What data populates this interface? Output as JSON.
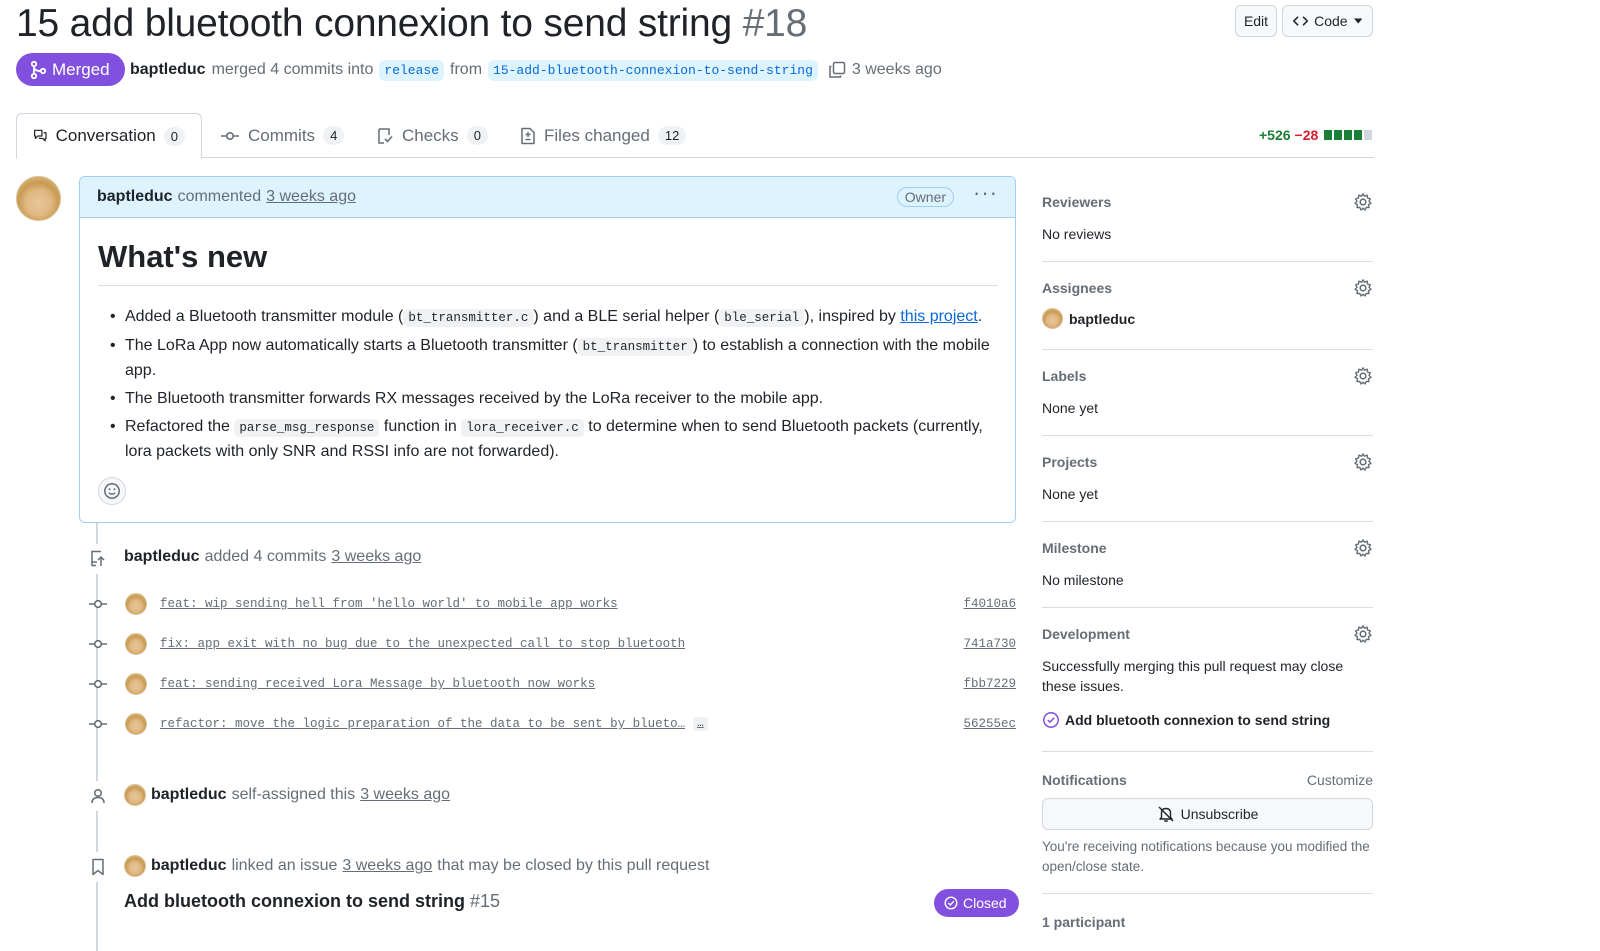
{
  "pr": {
    "title": "15 add bluetooth connexion to send string",
    "number": "#18",
    "state": "Merged",
    "author": "baptleduc",
    "merged_text": "merged 4 commits into",
    "base_branch": "release",
    "from_text": "from",
    "head_branch": "15-add-bluetooth-connexion-to-send-string",
    "time": "3 weeks ago",
    "edit_label": "Edit",
    "code_label": "Code"
  },
  "tabs": [
    {
      "label": "Conversation",
      "count": "0"
    },
    {
      "label": "Commits",
      "count": "4"
    },
    {
      "label": "Checks",
      "count": "0"
    },
    {
      "label": "Files changed",
      "count": "12"
    }
  ],
  "diffstat": {
    "additions": "+526",
    "deletions": "−28",
    "blocks": [
      1,
      1,
      1,
      1,
      0
    ]
  },
  "comment": {
    "author": "baptleduc",
    "action": "commented",
    "time": "3 weeks ago",
    "role": "Owner",
    "heading": "What's new",
    "items": [
      {
        "t1": "Added a Bluetooth transmitter module (",
        "c1": "bt_transmitter.c",
        "t2": ") and a BLE serial helper (",
        "c2": "ble_serial",
        "t3": "), inspired by ",
        "link": "this project",
        "t4": "."
      },
      {
        "t1": "The LoRa App now automatically starts a Bluetooth transmitter (",
        "c1": "bt_transmitter",
        "t2": ") to establish a connection with the mobile app."
      },
      {
        "t1": "The Bluetooth transmitter forwards RX messages received by the LoRa receiver to the mobile app."
      },
      {
        "t1": "Refactored the ",
        "c1": "parse_msg_response",
        "t2": " function in ",
        "c2": "lora_receiver.c",
        "t3": " to determine when to send Bluetooth packets (currently, lora packets with only SNR and RSSI info are not forwarded)."
      }
    ]
  },
  "timeline": {
    "commits_event": {
      "author": "baptleduc",
      "action": "added 4 commits",
      "time": "3 weeks ago"
    },
    "commits": [
      {
        "message": "feat: wip sending hell from 'hello world' to mobile app works",
        "sha": "f4010a6",
        "ellipsis": ""
      },
      {
        "message": "fix: app exit with no bug due to the unexpected call to stop bluetooth",
        "sha": "741a730",
        "ellipsis": ""
      },
      {
        "message": "feat: sending received Lora Message by bluetooth now works",
        "sha": "fbb7229",
        "ellipsis": ""
      },
      {
        "message": "refactor: move the logic preparation of the data to be sent by blueto…",
        "sha": "56255ec",
        "ellipsis": "…"
      }
    ],
    "assign_event": {
      "author": "baptleduc",
      "action": "self-assigned this",
      "time": "3 weeks ago"
    },
    "link_event": {
      "author": "baptleduc",
      "action": "linked an issue",
      "time": "3 weeks ago",
      "suffix": "that may be closed by this pull request"
    },
    "linked_issue": {
      "title": "Add bluetooth connexion to send string",
      "number": "#15",
      "state": "Closed"
    }
  },
  "sidebar": {
    "reviewers": {
      "label": "Reviewers",
      "value": "No reviews"
    },
    "assignees": {
      "label": "Assignees",
      "value": "baptleduc"
    },
    "labels": {
      "label": "Labels",
      "value": "None yet"
    },
    "projects": {
      "label": "Projects",
      "value": "None yet"
    },
    "milestone": {
      "label": "Milestone",
      "value": "No milestone"
    },
    "development": {
      "label": "Development",
      "desc": "Successfully merging this pull request may close these issues.",
      "issue": "Add bluetooth connexion to send string"
    },
    "notifications": {
      "label": "Notifications",
      "customize": "Customize",
      "button": "Unsubscribe",
      "desc": "You're receiving notifications because you modified the open/close state."
    },
    "participants": {
      "label": "1 participant"
    }
  },
  "colors": {
    "merged": "#8250df",
    "link": "#0969da",
    "add": "#1a7f37",
    "del": "#cf222e"
  }
}
